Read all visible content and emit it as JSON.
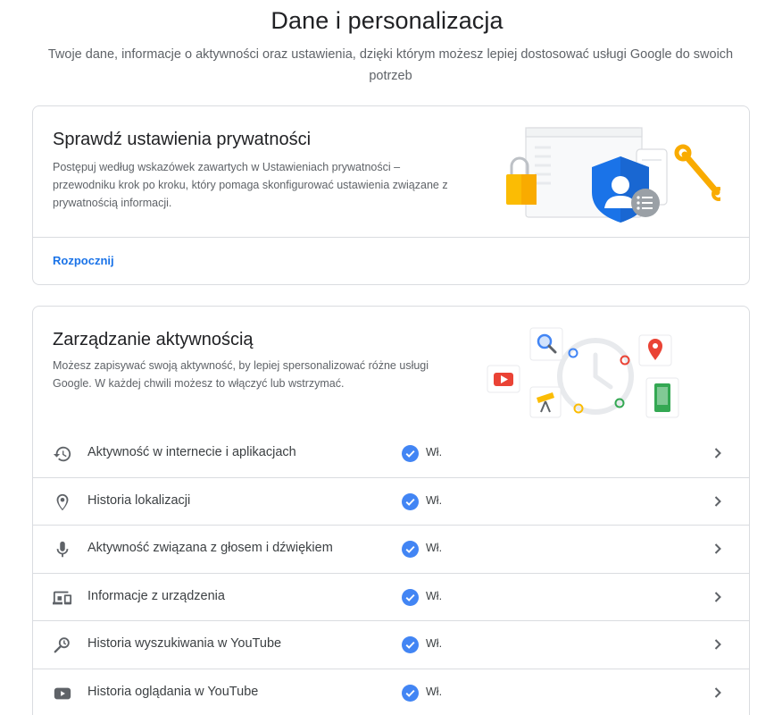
{
  "page": {
    "title": "Dane i personalizacja",
    "subtitle": "Twoje dane, informacje o aktywności oraz ustawienia, dzięki którym możesz lepiej dostosować usługi Google do swoich potrzeb"
  },
  "privacy_card": {
    "title": "Sprawdź ustawienia prywatności",
    "description": "Postępuj według wskazówek zawartych w Ustawieniach prywatności – przewodniku krok po kroku, który pomaga skonfigurować ustawienia związane z prywatnością informacji.",
    "action_label": "Rozpocznij"
  },
  "activity_card": {
    "title": "Zarządzanie aktywnością",
    "description": "Możesz zapisywać swoją aktywność, by lepiej spersonalizować różne usługi Google. W każdej chwili możesz to włączyć lub wstrzymać.",
    "rows": [
      {
        "label": "Aktywność w internecie i aplikacjach",
        "status": "Wł.",
        "icon": "history-icon"
      },
      {
        "label": "Historia lokalizacji",
        "status": "Wł.",
        "icon": "location-pin-icon"
      },
      {
        "label": "Aktywność związana z głosem i dźwiękiem",
        "status": "Wł.",
        "icon": "microphone-icon"
      },
      {
        "label": "Informacje z urządzenia",
        "status": "Wł.",
        "icon": "devices-icon"
      },
      {
        "label": "Historia wyszukiwania w YouTube",
        "status": "Wł.",
        "icon": "search-history-icon"
      },
      {
        "label": "Historia oglądania w YouTube",
        "status": "Wł.",
        "icon": "youtube-icon"
      }
    ]
  },
  "colors": {
    "accent": "#1a73e8",
    "check": "#4285f4",
    "shield": "#1a73e8",
    "lock": "#fbbc04",
    "wrench": "#f9ab00"
  }
}
